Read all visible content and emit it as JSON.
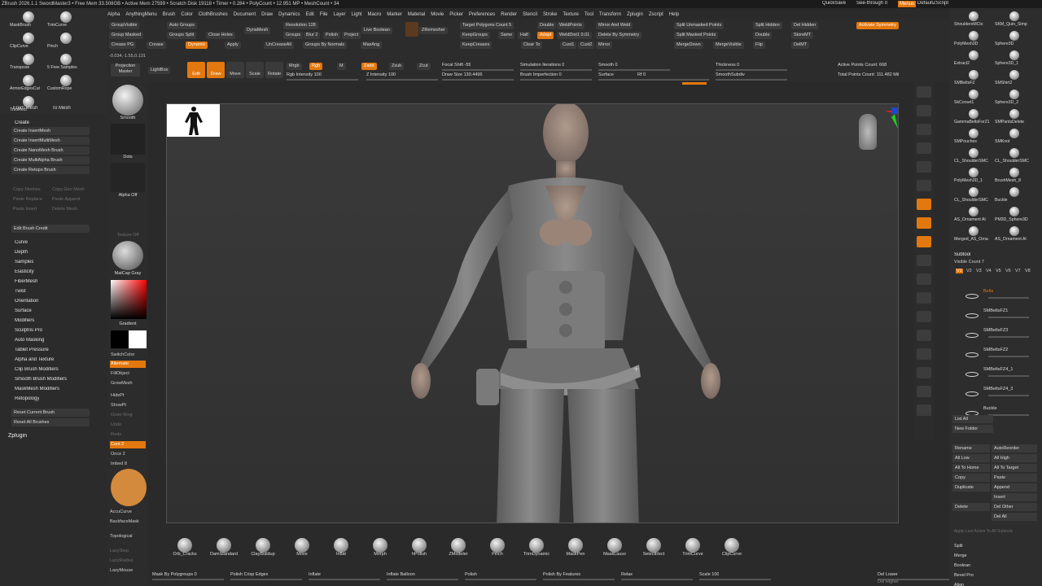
{
  "titlebar": {
    "text": "ZBrush 2026.1.1   SwordMaster3  • Free Mem 33.508GB • Active Mem 27599 • Scratch Disk 19118 • Timer • 0.284 • PolyCount • 12.951 MP • MeshCount • 34",
    "quicksave": "QuickSave",
    "seethrough": "See-through 0",
    "menus": "Menus",
    "defaultscript": "DefaultZScript"
  },
  "menus": [
    "Alpha",
    "AnythingMenu",
    "Brush",
    "Color",
    "ClothBrushes",
    "Document",
    "Draw",
    "Dynamics",
    "Edit",
    "File",
    "Layer",
    "Light",
    "Macro",
    "Marker",
    "Material",
    "Movie",
    "Picker",
    "Preferences",
    "Render",
    "Stencil",
    "Stroke",
    "Texture",
    "Tool",
    "Transform",
    "Zplugin",
    "Zscript",
    "Help"
  ],
  "toolbar": {
    "group_visible": "GroupVisible",
    "auto_groups": "Auto Groups",
    "group_masked": "Group Masked",
    "groups_split": "Groups Split",
    "close_holes": "Close Holes",
    "dynamesh": "DynaMesh",
    "resolution": "Resolution 128",
    "groups": "Groups",
    "blur": "Blur 2",
    "polish": "Polish",
    "project": "Project",
    "live_boolean": "Live Boolean",
    "zremesher": "ZRemesher",
    "target_poly": "Target Polygons Count 5",
    "keepgroups": "KeepGroups",
    "same": "Same",
    "half": "Half",
    "adapt": "Adapt",
    "keepcreases": "KeepCreases",
    "clear_to": "Clear To",
    "double": "Double",
    "weldpoints": "WeldPoints",
    "weld_dist": "WeldDist1 0.01",
    "cust1": "Cust1",
    "cust2": "Cust2",
    "mirror_and_weld": "Mirror And Weld",
    "delete_by_sym": "Delete By Symmetry",
    "mirror": "Mirror",
    "split_unmasked": "Split Unmasked Points",
    "split_masked": "Split Masked Points",
    "mergedown": "MergeDown",
    "mergevisible": "MergeVisible",
    "split_hidden": "Split Hidden",
    "del_hidden": "Del Hidden",
    "double2": "Double",
    "flip": "Flip",
    "storemt": "StoreMT",
    "delmt": "DelMT",
    "activate_symmetry": "Activate Symmetry",
    "crease_pg": "Crease PG",
    "crease": "Crease",
    "dynamic": "Dynamic",
    "apply": "Apply",
    "uncreaseall": "UnCreaseAll",
    "groups_by_normals": "Groups By Normals",
    "maxang": "MaxAng",
    "coords": "-0.034,-1.55,0.131",
    "projection_master": "Projection Master",
    "lightbox": "LightBox",
    "draw": "Draw",
    "move": "Move",
    "scale": "Scale",
    "rotate": "Rotate",
    "edit": "Edit",
    "mrgb": "Mrgb",
    "rgb": "Rgb",
    "m": "M",
    "zadd": "Zadd",
    "zsub": "Zsub",
    "zcut": "Zcut",
    "rgb_intensity": "Rgb Intensity 100",
    "z_intensity": "Z Intensity 100",
    "focal_shift": "Focal Shift -55",
    "draw_size": "Draw Size 130.4496",
    "dynamic_lbl": "Dynamic",
    "sim_iterations": "Simulation Iterations 0",
    "brush_imperfection": "Brush Imperfection 0",
    "smooth": "Smooth 0",
    "surface": "Surface",
    "rf": "Rf 0",
    "thickness": "Thickness 0",
    "smoothsubdiv": "SmoothSubdiv",
    "active_points": "Active Points Count: 668",
    "total_points": "Total Points Count: 111.482 Mil"
  },
  "left_tools": {
    "items": [
      "MaskBrush",
      "TrimCurve",
      "ClipCurve",
      "Pinch",
      "Transpose",
      "5 Free Samples",
      "ArmorEdgesCut",
      "CustomRope",
      "TrimRect"
    ],
    "from_mesh": "From Mesh",
    "to_mesh": "To Mesh"
  },
  "create_panel": {
    "header": "Create",
    "items": [
      "Create InsertMesh",
      "Create InsertMultiMesh",
      "Create NanoMesh Brush",
      "Create MultiAlpha Brush",
      "Create Retopo Brush"
    ],
    "dim_items": [
      "Copy Meshes",
      "Copy Geo Mesh",
      "Paste Replace",
      "Paste Append",
      "Paste Insert",
      "Delete Mesh"
    ],
    "edit_credit": "Edit Brush Credit"
  },
  "brush_menu": [
    "Curve",
    "Depth",
    "Samples",
    "Elasticity",
    "FiberMesh",
    "Twist",
    "Orientation",
    "Surface",
    "Modifiers",
    "Sculptris Pro",
    "Auto Masking",
    "Tablet Pressure",
    "Alpha and Texture",
    "Clip Brush Modifiers",
    "Smooth Brush Modifiers",
    "MaskMesh Modifiers",
    "Retopology"
  ],
  "reset": {
    "current": "Reset Current Brush",
    "all": "Reset All Brushes"
  },
  "zplugin": "Zplugin",
  "shelf": {
    "smooth": "Smooth",
    "dots": "Dots",
    "alpha_off": "Alpha Off",
    "texture_off": "Texture Off",
    "matcap": "MatCap Gray",
    "gradient": "Gradient",
    "switchcolor": "SwitchColor",
    "alternate": "Alternate",
    "fillobject": "FillObject",
    "growmesh": "GrowMesh",
    "hidept": "HidePt",
    "showpt": "ShowPt",
    "outer_ring": "Outer Ring",
    "undo": "Undo",
    "redo": "Redo",
    "cont": "Cont 2",
    "once": "Once 2",
    "imbed": "Imbed 8",
    "accucurve": "AccuCurve",
    "backfacemask": "BackfaceMask",
    "topological": "Topological",
    "lazystep": "LazyStep",
    "lazyradius": "LazyRadius",
    "lazymouse": "LazyMouse"
  },
  "bottom_brushes": [
    "Orb_Cracks",
    "DamStandard",
    "ClayBuildup",
    "Move",
    "Inflat",
    "Morph",
    "hPolish",
    "ZModeler",
    "Pinch",
    "TrimDynamic",
    "MaskPen",
    "MaskLasso",
    "SelectRect",
    "TrimCurve",
    "ClipCurve"
  ],
  "bottom_sliders": {
    "mask_by_polygroups": "Mask By Polygroups 0",
    "polish_crisp": "Polish Crisp Edges",
    "inflate": "Inflate",
    "inflate_balloon": "Inflate Balloon",
    "polish": "Polish",
    "polish_by_features": "Polish By Features",
    "relax": "Relax",
    "scale": "Scale 100",
    "del_lower": "Del Lower",
    "del_higher": "Del Higher"
  },
  "right_shelf": [
    "BPR",
    "SPix 3",
    "Actual",
    "AAHalf",
    "Persp",
    "Floor",
    "Local",
    "LSym",
    "Qxyz",
    "Frame",
    "Move",
    "ZoomD",
    "Rotate",
    "Line Fill",
    "Transp",
    "Dynamic",
    "Solo",
    "Xpose"
  ],
  "subtool": {
    "header": "Subtool",
    "visible_count": "Visible Count 7",
    "versions": [
      "V1",
      "V2",
      "V3",
      "V4",
      "V5",
      "V6",
      "V7",
      "V8"
    ],
    "items": [
      "Belts",
      "SMBeltsFZ1",
      "SMBeltsFZ3",
      "SMBeltsFZ2",
      "SMBeltsFZ4_1",
      "SMBeltsFZ4_3",
      "Buckle"
    ],
    "list_all": "List All",
    "new_folder": "New Folder",
    "rename": "Rename",
    "autoreorder": "AutoReorder",
    "all_low": "All Low",
    "all_high": "All High",
    "all_to_home": "All To Home",
    "all_to_target": "All To Target",
    "copy": "Copy",
    "paste": "Paste",
    "duplicate": "Duplicate",
    "append": "Append",
    "insert": "Insert",
    "delete": "Delete",
    "del_other": "Del Other",
    "del_all": "Del All",
    "apply_last": "Apply Last Action To All Subtools",
    "split": "Split",
    "merge": "Merge",
    "boolean": "Boolean",
    "bevel_pro": "Bevel Pro",
    "align": "Align"
  },
  "right_tools": [
    "ShouldersMClo",
    "SKM_Quin_Simp",
    "PolyMesh3D",
    "Sphere3D",
    "Extract2",
    "Sphere3D_1",
    "SMBeltsFZ",
    "SMShirt2",
    "SkCorset1",
    "Sphere3D_2",
    "GammaBeltsFor21",
    "SMPantsDelete",
    "SMPouches",
    "SMKnot",
    "CL_ShoulderSMC",
    "CL_ShoulderSMC",
    "PolyMesh3D_1",
    "BrushMesh_8",
    "CL_ShoulderSMC",
    "Buckle",
    "AS_Ornament Al",
    "PM3D_Sphere3D",
    "Merged_AS_Orna",
    "AS_Ornament Al"
  ],
  "colors": {
    "accent": "#e3780e",
    "bg": "#2a2a2a",
    "panel": "#2d2d2d"
  }
}
